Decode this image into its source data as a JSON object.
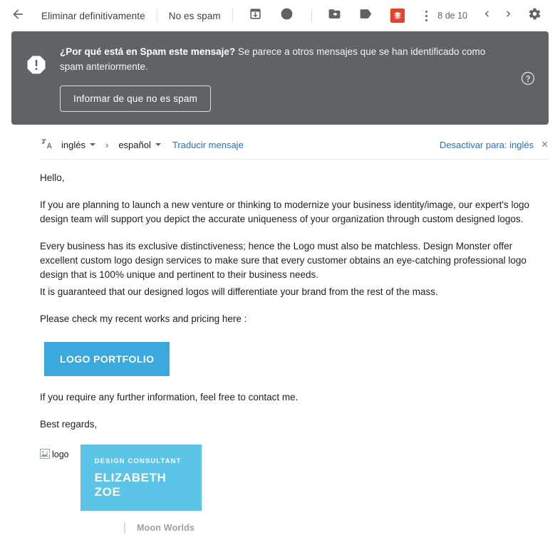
{
  "toolbar": {
    "back_icon": "back-arrow-icon",
    "delete_forever_label": "Eliminar definitivamente",
    "not_spam_label": "No es spam",
    "icons": [
      {
        "name": "archive-icon",
        "title": "Archivar"
      },
      {
        "name": "snooze-clock-icon",
        "title": "Posponer"
      },
      {
        "name": "move-to-folder-icon",
        "title": "Mover a"
      },
      {
        "name": "label-tag-icon",
        "title": "Etiquetas"
      },
      {
        "name": "addon-red-icon",
        "title": "Complemento"
      }
    ],
    "more_options_icon": "more-options-kebab-icon",
    "pagination_label": "8 de 10",
    "prev_icon": "chevron-left-icon",
    "next_icon": "chevron-right-icon",
    "settings_icon": "gear-icon",
    "addon_color": "#e8402a"
  },
  "spam_banner": {
    "alert_icon": "alert-octagon-icon",
    "heading": "¿Por qué está en Spam este mensaje?",
    "description": " Se parece a otros mensajes que se han identificado como spam anteriormente.",
    "button_label": "Informar de que no es spam",
    "help_icon": "help-circle-icon",
    "background_color": "#5f6368"
  },
  "translate_bar": {
    "translate_icon": "translate-icon",
    "source_language": "inglés",
    "arrow": "›",
    "target_language": "español",
    "translate_link": "Traducir mensaje",
    "disable_link": "Desactivar para: inglés",
    "close_icon": "close-x-icon",
    "link_color": "#1a73e8"
  },
  "message": {
    "greeting": "Hello,",
    "paragraph_1": "If you are planning to launch a new venture or thinking to modernize your business identity/image, our expert's logo design team will support you depict the accurate uniqueness of your organization through custom designed logos.",
    "paragraph_2": "Every business has its exclusive distinctiveness; hence the Logo must also be matchless. Design Monster offer excellent custom logo design services to make sure that every customer obtains an eye-catching professional logo design that is 100% unique and pertinent to their business needs.",
    "paragraph_3": "It is guaranteed that our designed logos will differentiate your brand from the rest of the mass.",
    "paragraph_4": "Please check my recent works and pricing here :",
    "cta_label": "LOGO PORTFOLIO",
    "cta_color": "#3aa9e0",
    "paragraph_5": "If you require any further information, feel free to contact me.",
    "closing": "Best regards,"
  },
  "signature": {
    "broken_image_alt": "logo",
    "broken_image_icon": "broken-image-icon",
    "role": "DESIGN CONSULTANT",
    "name": "ELIZABETH ZOE",
    "company": "Moon Worlds",
    "card_color": "#5bc4e7"
  }
}
